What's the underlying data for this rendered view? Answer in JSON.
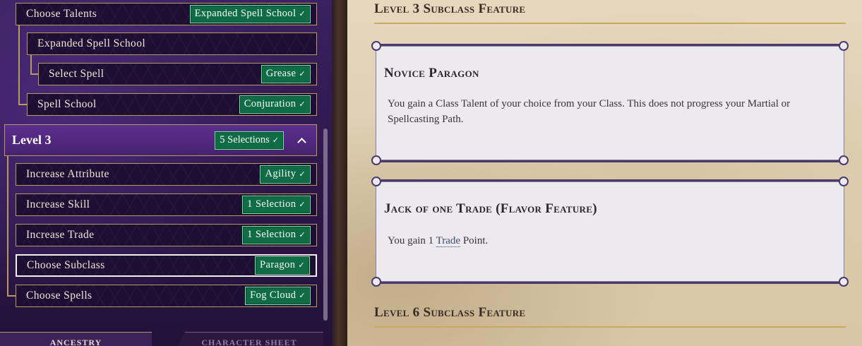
{
  "left_panel": {
    "rows_top": [
      {
        "label": "Choose Talents",
        "badge": "Expanded Spell School"
      },
      {
        "label": "Expanded Spell School",
        "badge": ""
      },
      {
        "label": "Select Spell",
        "badge": "Grease"
      },
      {
        "label": "Spell School",
        "badge": "Conjuration"
      }
    ],
    "level3": {
      "title": "Level 3",
      "badge": "5 Selections"
    },
    "level3_rows": [
      {
        "label": "Increase Attribute",
        "badge": "Agility"
      },
      {
        "label": "Increase Skill",
        "badge": "1 Selection"
      },
      {
        "label": "Increase Trade",
        "badge": "1 Selection"
      },
      {
        "label": "Choose Subclass",
        "badge": "Paragon"
      },
      {
        "label": "Choose Spells",
        "badge": "Fog Cloud"
      }
    ],
    "check_glyph": "✓",
    "tabs": {
      "ancestry": "ANCESTRY",
      "character_sheet": "CHARACTER SHEET"
    }
  },
  "right_panel": {
    "section1": "Level 3 Subclass Feature",
    "card1": {
      "title": "Novice Paragon",
      "body": "You gain a Class Talent of your choice from your Class. This does not progress your Martial or Spellcasting Path."
    },
    "card2": {
      "title": "Jack of one Trade (Flavor Feature)",
      "body_prefix": "You gain 1 ",
      "body_link": "Trade",
      "body_suffix": " Point."
    },
    "section2": "Level 6 Subclass Feature"
  },
  "colors": {
    "badge_green": "#0f6c45",
    "row_border": "#b79a62",
    "panel_purple": "#2c1748",
    "parchment": "#ddcdaf",
    "card_border": "#4a3a6a"
  }
}
